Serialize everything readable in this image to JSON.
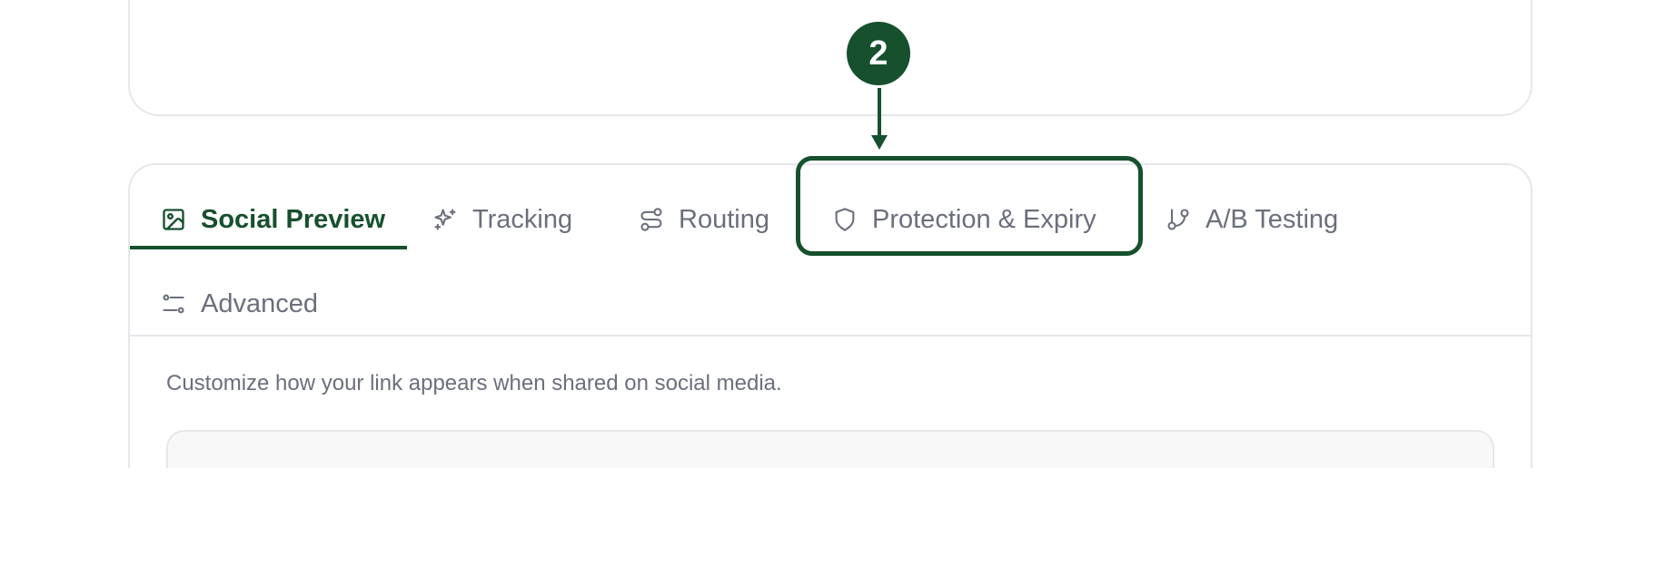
{
  "tabs": [
    {
      "label": "Social Preview",
      "icon": "image-icon",
      "active": true
    },
    {
      "label": "Tracking",
      "icon": "sparkles-icon",
      "active": false
    },
    {
      "label": "Routing",
      "icon": "route-icon",
      "active": false
    },
    {
      "label": "Protection & Expiry",
      "icon": "shield-icon",
      "active": false
    },
    {
      "label": "A/B Testing",
      "icon": "git-branch-icon",
      "active": false
    },
    {
      "label": "Advanced",
      "icon": "sliders-icon",
      "active": false
    }
  ],
  "content": {
    "description": "Customize how your link appears when shared on social media."
  },
  "annotation": {
    "step_number": "2",
    "target": "Protection & Expiry"
  },
  "colors": {
    "accent": "#16502d",
    "muted_text": "#6b6f7b",
    "border": "#e5e7eb",
    "preview_bg": "#f8f8f8"
  }
}
